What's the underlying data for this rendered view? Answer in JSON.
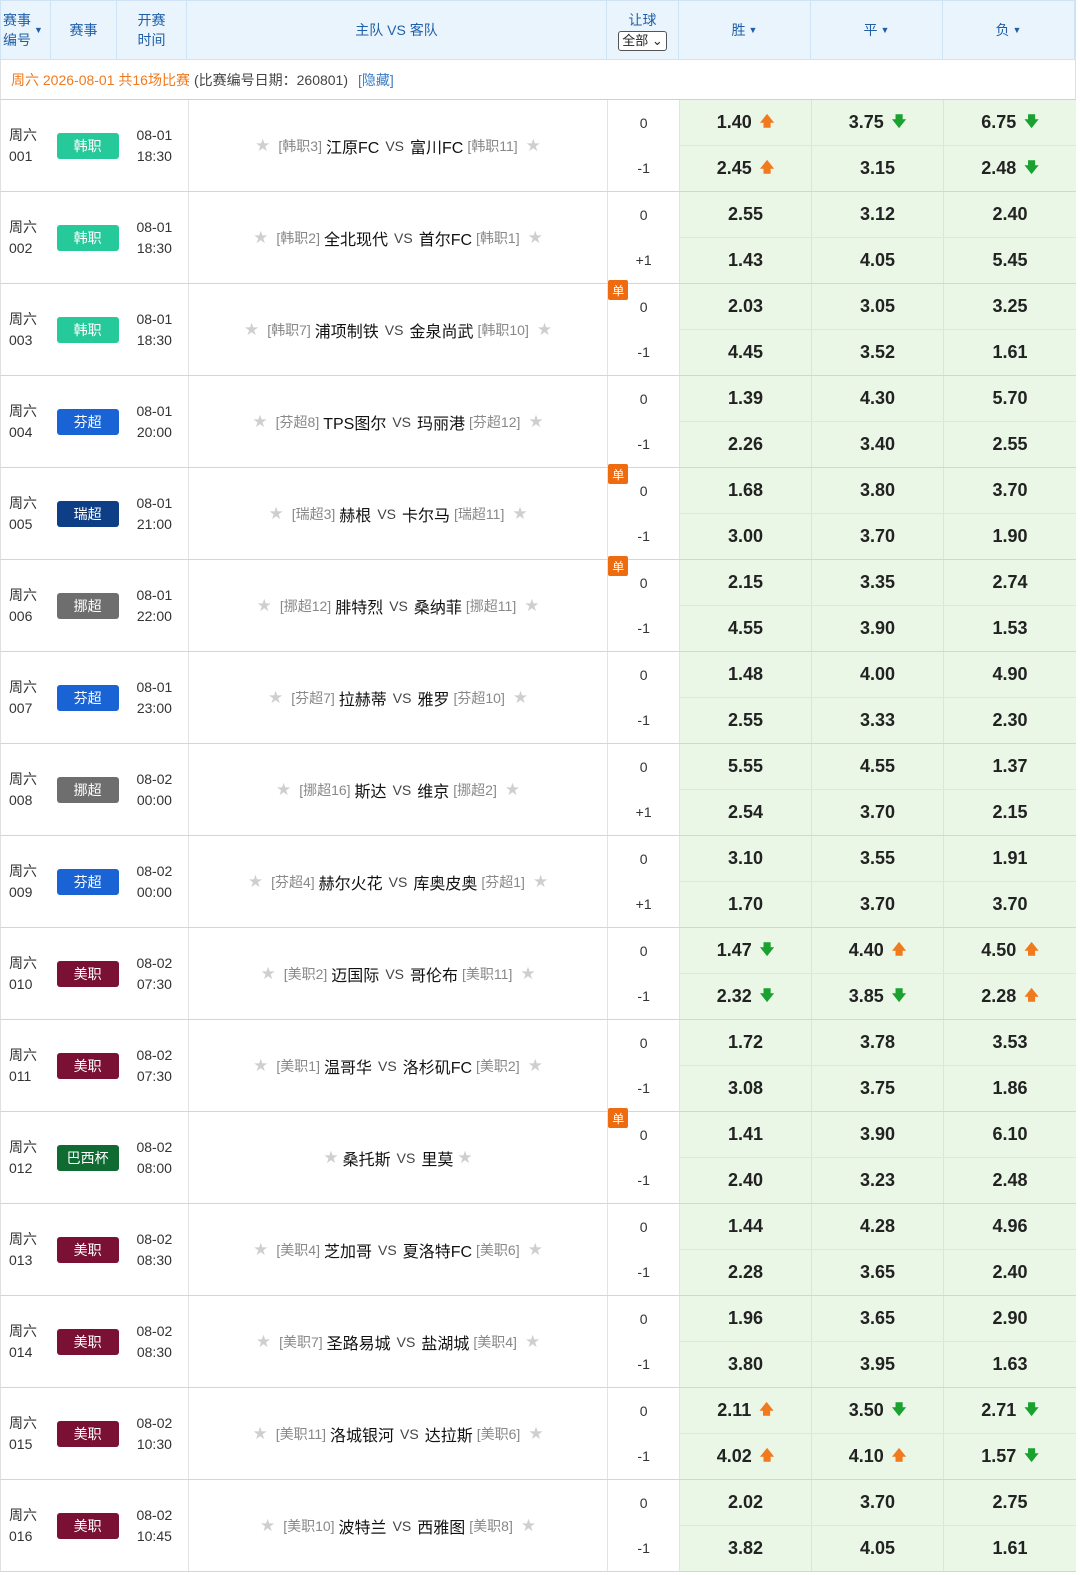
{
  "header": {
    "id_label_line1": "赛事",
    "id_label_line2": "编号",
    "league_label": "赛事",
    "time_label_line1": "开赛",
    "time_label_line2": "时间",
    "match_label": "主队 VS 客队",
    "handicap_label": "让球",
    "handicap_filter": "全部",
    "win_label": "胜",
    "draw_label": "平",
    "lose_label": "负"
  },
  "date_row": {
    "date": "周六 2026-08-01 共16场比赛",
    "info": "(比赛编号日期：260801)",
    "hide_link": "[隐藏]"
  },
  "icons": {
    "star": "star-icon",
    "up": "arrow-up-icon",
    "down": "arrow-down-icon",
    "caret": "caret-down-icon"
  },
  "vs_text": "VS",
  "single_text": "单",
  "colors": {
    "kleague": "#26c99a",
    "finland": "#1a63d4",
    "sweden": "#0e3f86",
    "norway": "#6e6e6e",
    "mls": "#7a1033",
    "brazil": "#0f6b32"
  },
  "matches": [
    {
      "day": "周六",
      "num": "001",
      "league": "韩职",
      "league_color": "#26c99a",
      "date": "08-01",
      "time": "18:30",
      "home_rank": "[韩职3]",
      "home": "江原FC",
      "away": "富川FC",
      "away_rank": "[韩职11]",
      "single": false,
      "hc": [
        "0",
        "-1"
      ],
      "odds": [
        [
          {
            "v": "1.40",
            "t": "up"
          },
          {
            "v": "3.75",
            "t": "down"
          },
          {
            "v": "6.75",
            "t": "down"
          }
        ],
        [
          {
            "v": "2.45",
            "t": "up"
          },
          {
            "v": "3.15",
            "t": ""
          },
          {
            "v": "2.48",
            "t": "down"
          }
        ]
      ]
    },
    {
      "day": "周六",
      "num": "002",
      "league": "韩职",
      "league_color": "#26c99a",
      "date": "08-01",
      "time": "18:30",
      "home_rank": "[韩职2]",
      "home": "全北现代",
      "away": "首尔FC",
      "away_rank": "[韩职1]",
      "single": false,
      "hc": [
        "0",
        "+1"
      ],
      "odds": [
        [
          {
            "v": "2.55",
            "t": ""
          },
          {
            "v": "3.12",
            "t": ""
          },
          {
            "v": "2.40",
            "t": ""
          }
        ],
        [
          {
            "v": "1.43",
            "t": ""
          },
          {
            "v": "4.05",
            "t": ""
          },
          {
            "v": "5.45",
            "t": ""
          }
        ]
      ]
    },
    {
      "day": "周六",
      "num": "003",
      "league": "韩职",
      "league_color": "#26c99a",
      "date": "08-01",
      "time": "18:30",
      "home_rank": "[韩职7]",
      "home": "浦项制铁",
      "away": "金泉尚武",
      "away_rank": "[韩职10]",
      "single": true,
      "hc": [
        "0",
        "-1"
      ],
      "odds": [
        [
          {
            "v": "2.03",
            "t": ""
          },
          {
            "v": "3.05",
            "t": ""
          },
          {
            "v": "3.25",
            "t": ""
          }
        ],
        [
          {
            "v": "4.45",
            "t": ""
          },
          {
            "v": "3.52",
            "t": ""
          },
          {
            "v": "1.61",
            "t": ""
          }
        ]
      ]
    },
    {
      "day": "周六",
      "num": "004",
      "league": "芬超",
      "league_color": "#1a63d4",
      "date": "08-01",
      "time": "20:00",
      "home_rank": "[芬超8]",
      "home": "TPS图尔",
      "away": "玛丽港",
      "away_rank": "[芬超12]",
      "single": false,
      "hc": [
        "0",
        "-1"
      ],
      "odds": [
        [
          {
            "v": "1.39",
            "t": ""
          },
          {
            "v": "4.30",
            "t": ""
          },
          {
            "v": "5.70",
            "t": ""
          }
        ],
        [
          {
            "v": "2.26",
            "t": ""
          },
          {
            "v": "3.40",
            "t": ""
          },
          {
            "v": "2.55",
            "t": ""
          }
        ]
      ]
    },
    {
      "day": "周六",
      "num": "005",
      "league": "瑞超",
      "league_color": "#0e3f86",
      "date": "08-01",
      "time": "21:00",
      "home_rank": "[瑞超3]",
      "home": "赫根",
      "away": "卡尔马",
      "away_rank": "[瑞超11]",
      "single": true,
      "hc": [
        "0",
        "-1"
      ],
      "odds": [
        [
          {
            "v": "1.68",
            "t": ""
          },
          {
            "v": "3.80",
            "t": ""
          },
          {
            "v": "3.70",
            "t": ""
          }
        ],
        [
          {
            "v": "3.00",
            "t": ""
          },
          {
            "v": "3.70",
            "t": ""
          },
          {
            "v": "1.90",
            "t": ""
          }
        ]
      ]
    },
    {
      "day": "周六",
      "num": "006",
      "league": "挪超",
      "league_color": "#6e6e6e",
      "date": "08-01",
      "time": "22:00",
      "home_rank": "[挪超12]",
      "home": "腓特烈",
      "away": "桑纳菲",
      "away_rank": "[挪超11]",
      "single": true,
      "hc": [
        "0",
        "-1"
      ],
      "odds": [
        [
          {
            "v": "2.15",
            "t": ""
          },
          {
            "v": "3.35",
            "t": ""
          },
          {
            "v": "2.74",
            "t": ""
          }
        ],
        [
          {
            "v": "4.55",
            "t": ""
          },
          {
            "v": "3.90",
            "t": ""
          },
          {
            "v": "1.53",
            "t": ""
          }
        ]
      ]
    },
    {
      "day": "周六",
      "num": "007",
      "league": "芬超",
      "league_color": "#1a63d4",
      "date": "08-01",
      "time": "23:00",
      "home_rank": "[芬超7]",
      "home": "拉赫蒂",
      "away": "雅罗",
      "away_rank": "[芬超10]",
      "single": false,
      "hc": [
        "0",
        "-1"
      ],
      "odds": [
        [
          {
            "v": "1.48",
            "t": ""
          },
          {
            "v": "4.00",
            "t": ""
          },
          {
            "v": "4.90",
            "t": ""
          }
        ],
        [
          {
            "v": "2.55",
            "t": ""
          },
          {
            "v": "3.33",
            "t": ""
          },
          {
            "v": "2.30",
            "t": ""
          }
        ]
      ]
    },
    {
      "day": "周六",
      "num": "008",
      "league": "挪超",
      "league_color": "#6e6e6e",
      "date": "08-02",
      "time": "00:00",
      "home_rank": "[挪超16]",
      "home": "斯达",
      "away": "维京",
      "away_rank": "[挪超2]",
      "single": false,
      "hc": [
        "0",
        "+1"
      ],
      "odds": [
        [
          {
            "v": "5.55",
            "t": ""
          },
          {
            "v": "4.55",
            "t": ""
          },
          {
            "v": "1.37",
            "t": ""
          }
        ],
        [
          {
            "v": "2.54",
            "t": ""
          },
          {
            "v": "3.70",
            "t": ""
          },
          {
            "v": "2.15",
            "t": ""
          }
        ]
      ]
    },
    {
      "day": "周六",
      "num": "009",
      "league": "芬超",
      "league_color": "#1a63d4",
      "date": "08-02",
      "time": "00:00",
      "home_rank": "[芬超4]",
      "home": "赫尔火花",
      "away": "库奥皮奥",
      "away_rank": "[芬超1]",
      "single": false,
      "hc": [
        "0",
        "+1"
      ],
      "odds": [
        [
          {
            "v": "3.10",
            "t": ""
          },
          {
            "v": "3.55",
            "t": ""
          },
          {
            "v": "1.91",
            "t": ""
          }
        ],
        [
          {
            "v": "1.70",
            "t": ""
          },
          {
            "v": "3.70",
            "t": ""
          },
          {
            "v": "3.70",
            "t": ""
          }
        ]
      ]
    },
    {
      "day": "周六",
      "num": "010",
      "league": "美职",
      "league_color": "#7a1033",
      "date": "08-02",
      "time": "07:30",
      "home_rank": "[美职2]",
      "home": "迈国际",
      "away": "哥伦布",
      "away_rank": "[美职11]",
      "single": false,
      "hc": [
        "0",
        "-1"
      ],
      "odds": [
        [
          {
            "v": "1.47",
            "t": "down"
          },
          {
            "v": "4.40",
            "t": "up"
          },
          {
            "v": "4.50",
            "t": "up"
          }
        ],
        [
          {
            "v": "2.32",
            "t": "down"
          },
          {
            "v": "3.85",
            "t": "down"
          },
          {
            "v": "2.28",
            "t": "up"
          }
        ]
      ]
    },
    {
      "day": "周六",
      "num": "011",
      "league": "美职",
      "league_color": "#7a1033",
      "date": "08-02",
      "time": "07:30",
      "home_rank": "[美职1]",
      "home": "温哥华",
      "away": "洛杉矶FC",
      "away_rank": "[美职2]",
      "single": false,
      "hc": [
        "0",
        "-1"
      ],
      "odds": [
        [
          {
            "v": "1.72",
            "t": ""
          },
          {
            "v": "3.78",
            "t": ""
          },
          {
            "v": "3.53",
            "t": ""
          }
        ],
        [
          {
            "v": "3.08",
            "t": ""
          },
          {
            "v": "3.75",
            "t": ""
          },
          {
            "v": "1.86",
            "t": ""
          }
        ]
      ]
    },
    {
      "day": "周六",
      "num": "012",
      "league": "巴西杯",
      "league_color": "#0f6b32",
      "date": "08-02",
      "time": "08:00",
      "home_rank": "",
      "home": "桑托斯",
      "away": "里莫",
      "away_rank": "",
      "single": true,
      "hc": [
        "0",
        "-1"
      ],
      "odds": [
        [
          {
            "v": "1.41",
            "t": ""
          },
          {
            "v": "3.90",
            "t": ""
          },
          {
            "v": "6.10",
            "t": ""
          }
        ],
        [
          {
            "v": "2.40",
            "t": ""
          },
          {
            "v": "3.23",
            "t": ""
          },
          {
            "v": "2.48",
            "t": ""
          }
        ]
      ]
    },
    {
      "day": "周六",
      "num": "013",
      "league": "美职",
      "league_color": "#7a1033",
      "date": "08-02",
      "time": "08:30",
      "home_rank": "[美职4]",
      "home": "芝加哥",
      "away": "夏洛特FC",
      "away_rank": "[美职6]",
      "single": false,
      "hc": [
        "0",
        "-1"
      ],
      "odds": [
        [
          {
            "v": "1.44",
            "t": ""
          },
          {
            "v": "4.28",
            "t": ""
          },
          {
            "v": "4.96",
            "t": ""
          }
        ],
        [
          {
            "v": "2.28",
            "t": ""
          },
          {
            "v": "3.65",
            "t": ""
          },
          {
            "v": "2.40",
            "t": ""
          }
        ]
      ]
    },
    {
      "day": "周六",
      "num": "014",
      "league": "美职",
      "league_color": "#7a1033",
      "date": "08-02",
      "time": "08:30",
      "home_rank": "[美职7]",
      "home": "圣路易城",
      "away": "盐湖城",
      "away_rank": "[美职4]",
      "single": false,
      "hc": [
        "0",
        "-1"
      ],
      "odds": [
        [
          {
            "v": "1.96",
            "t": ""
          },
          {
            "v": "3.65",
            "t": ""
          },
          {
            "v": "2.90",
            "t": ""
          }
        ],
        [
          {
            "v": "3.80",
            "t": ""
          },
          {
            "v": "3.95",
            "t": ""
          },
          {
            "v": "1.63",
            "t": ""
          }
        ]
      ]
    },
    {
      "day": "周六",
      "num": "015",
      "league": "美职",
      "league_color": "#7a1033",
      "date": "08-02",
      "time": "10:30",
      "home_rank": "[美职11]",
      "home": "洛城银河",
      "away": "达拉斯",
      "away_rank": "[美职6]",
      "single": false,
      "hc": [
        "0",
        "-1"
      ],
      "odds": [
        [
          {
            "v": "2.11",
            "t": "up"
          },
          {
            "v": "3.50",
            "t": "down"
          },
          {
            "v": "2.71",
            "t": "down"
          }
        ],
        [
          {
            "v": "4.02",
            "t": "up"
          },
          {
            "v": "4.10",
            "t": "up"
          },
          {
            "v": "1.57",
            "t": "down"
          }
        ]
      ]
    },
    {
      "day": "周六",
      "num": "016",
      "league": "美职",
      "league_color": "#7a1033",
      "date": "08-02",
      "time": "10:45",
      "home_rank": "[美职10]",
      "home": "波特兰",
      "away": "西雅图",
      "away_rank": "[美职8]",
      "single": false,
      "hc": [
        "0",
        "-1"
      ],
      "odds": [
        [
          {
            "v": "2.02",
            "t": ""
          },
          {
            "v": "3.70",
            "t": ""
          },
          {
            "v": "2.75",
            "t": ""
          }
        ],
        [
          {
            "v": "3.82",
            "t": ""
          },
          {
            "v": "4.05",
            "t": ""
          },
          {
            "v": "1.61",
            "t": ""
          }
        ]
      ]
    }
  ]
}
